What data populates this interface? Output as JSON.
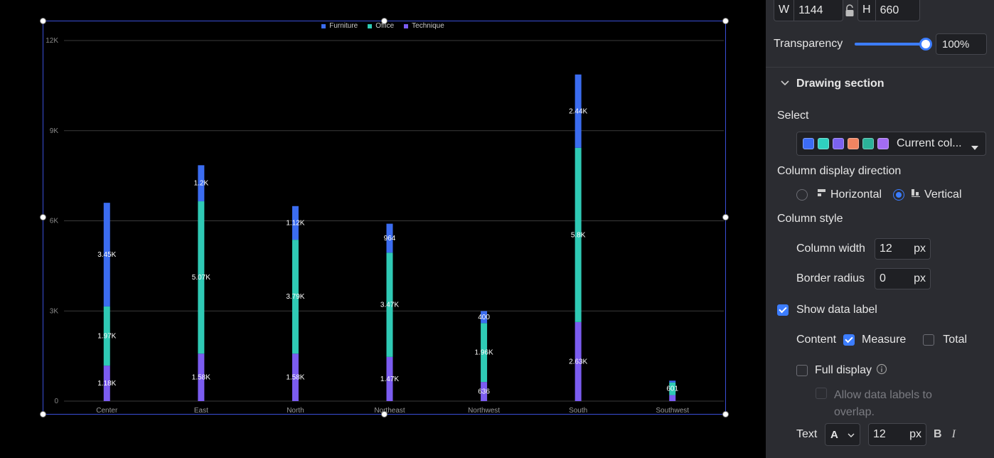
{
  "chart_data": {
    "type": "bar",
    "stacked": true,
    "categories": [
      "Center",
      "East",
      "North",
      "Northeast",
      "Northwest",
      "South",
      "Southwest"
    ],
    "series": [
      {
        "name": "Technique",
        "color": "#7b5cf0",
        "values": [
          1180,
          1580,
          1580,
          1470,
          636,
          2630,
          200
        ],
        "labels": [
          "1.18K",
          "1.58K",
          "1.58K",
          "1.47K",
          "636",
          "2.63K",
          ""
        ]
      },
      {
        "name": "Office",
        "color": "#2fcab5",
        "values": [
          1970,
          5070,
          3790,
          3470,
          1960,
          5800,
          420
        ],
        "labels": [
          "1.97K",
          "5.07K",
          "3.79K",
          "3.47K",
          "1.96K",
          "5.8K",
          "601"
        ]
      },
      {
        "name": "Furniture",
        "color": "#3b6cf0",
        "values": [
          3450,
          1200,
          1120,
          964,
          400,
          2440,
          60
        ],
        "labels": [
          "3.45K",
          "1.2K",
          "1.12K",
          "964",
          "400",
          "2.44K",
          ""
        ]
      }
    ],
    "legend_order": [
      "Furniture",
      "Office",
      "Technique"
    ],
    "y_ticks": [
      {
        "value": 0,
        "label": "0"
      },
      {
        "value": 3000,
        "label": "3K"
      },
      {
        "value": 6000,
        "label": "6K"
      },
      {
        "value": 9000,
        "label": "9K"
      },
      {
        "value": 12000,
        "label": "12K"
      }
    ],
    "ylim": [
      0,
      12000
    ],
    "grid": true,
    "legend_position": "top-center"
  },
  "panel": {
    "w_label": "W",
    "w_value": "1144",
    "h_label": "H",
    "h_value": "660",
    "transparency_label": "Transparency",
    "transparency_value": "100%",
    "transparency_level": 1.0,
    "drawing_section_title": "Drawing section",
    "select_label": "Select",
    "color_scheme_label": "Current col...",
    "scheme_colors": [
      "#3c6cf5",
      "#2fd0c0",
      "#7b62f0",
      "#f08461",
      "#2bb39a",
      "#a36cf2"
    ],
    "column_direction_label": "Column display direction",
    "horizontal_label": "Horizontal",
    "vertical_label": "Vertical",
    "column_style_label": "Column style",
    "column_width_label": "Column width",
    "column_width_value": "12",
    "column_width_unit": "px",
    "border_radius_label": "Border radius",
    "border_radius_value": "0",
    "border_radius_unit": "px",
    "show_data_label": "Show data label",
    "content_label": "Content",
    "measure_label": "Measure",
    "total_label": "Total",
    "full_display_label": "Full display",
    "allow_overlap_line1": "Allow data labels to",
    "allow_overlap_line2": "overlap.",
    "text_label": "Text",
    "text_font_label": "A",
    "text_size_value": "12",
    "text_size_unit": "px",
    "bold_label": "B",
    "italic_label": "I"
  }
}
